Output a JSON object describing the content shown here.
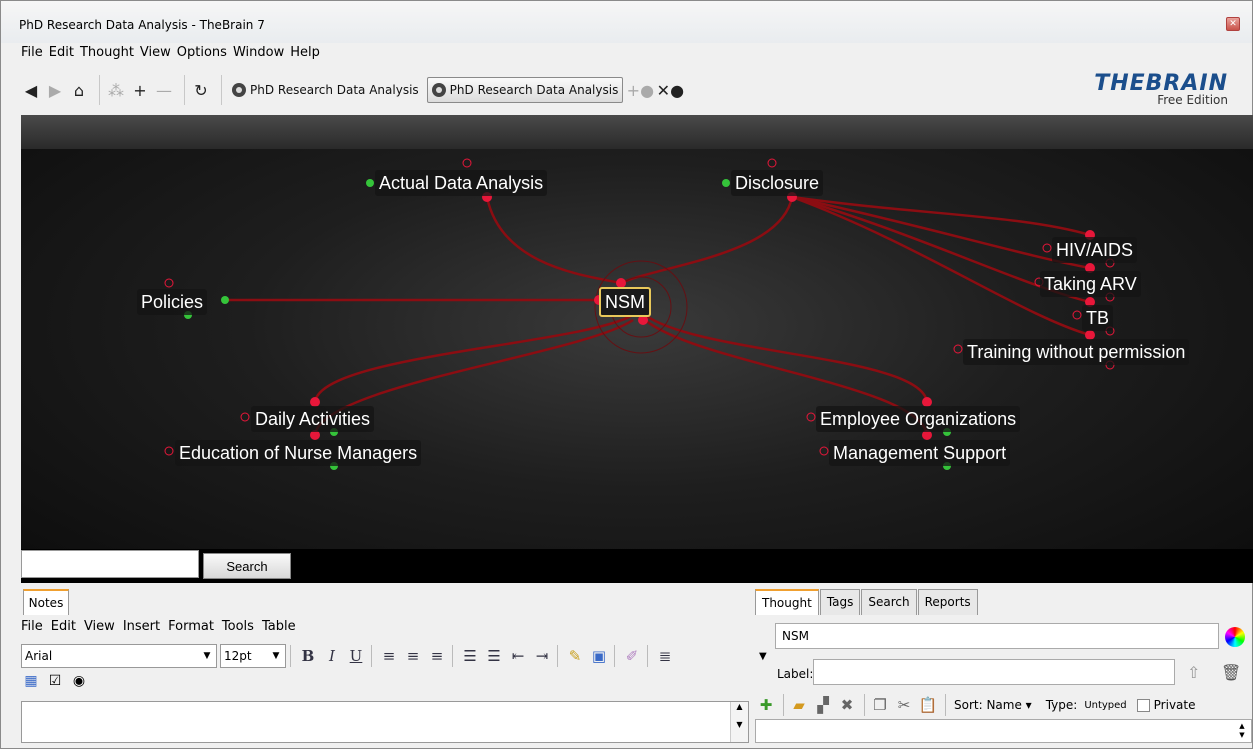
{
  "window": {
    "title": "PhD Research Data Analysis - TheBrain 7"
  },
  "menubar": [
    "File",
    "Edit",
    "Thought",
    "View",
    "Options",
    "Window",
    "Help"
  ],
  "toolbar": {
    "tabs": [
      {
        "label": "PhD Research Data Analysis",
        "active": false
      },
      {
        "label": "PhD Research Data Analysis",
        "active": true
      }
    ]
  },
  "brand": {
    "name": "THEBRAIN",
    "edition": "Free Edition"
  },
  "brain": {
    "center": "NSM",
    "parents": [
      "Actual Data Analysis",
      "Disclosure"
    ],
    "jumps": [
      "Policies"
    ],
    "children": [
      "Daily Activities",
      "Education of Nurse Managers",
      "Employee Organizations",
      "Management Support"
    ],
    "disclosure_children": [
      "HIV/AIDS",
      "Taking ARV",
      "TB",
      "Training without permission"
    ]
  },
  "search": {
    "button": "Search",
    "value": ""
  },
  "notes": {
    "tab": "Notes",
    "menu": [
      "File",
      "Edit",
      "View",
      "Insert",
      "Format",
      "Tools",
      "Table"
    ],
    "font": "Arial",
    "size": "12pt"
  },
  "thought_panel": {
    "tabs": [
      "Thought",
      "Tags",
      "Search",
      "Reports"
    ],
    "name": "NSM",
    "label_caption": "Label:",
    "label_value": "",
    "sort": "Sort: Name",
    "type_caption": "Type:",
    "type_value": "Untyped",
    "private": "Private"
  },
  "colors": {
    "link": "#8b0d12",
    "node_red": "#e8173a",
    "node_green": "#35c43a",
    "active_border": "#e8c85a"
  }
}
